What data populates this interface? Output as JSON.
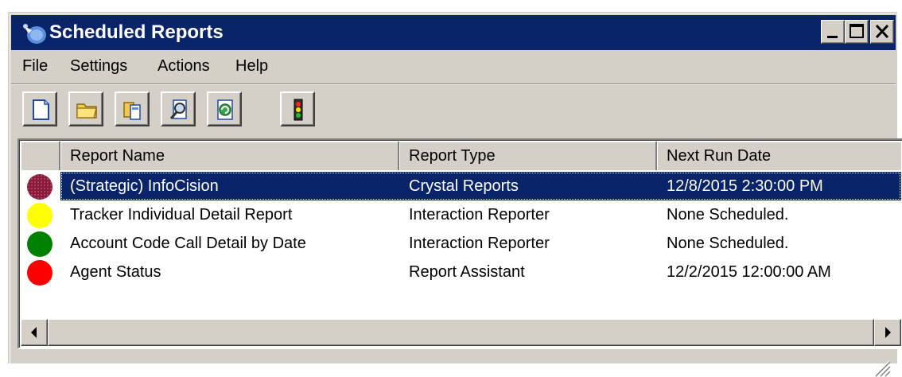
{
  "window": {
    "title": "Scheduled Reports"
  },
  "menu": [
    "File",
    "Settings",
    "Actions",
    "Help"
  ],
  "toolbar": {
    "buttons": [
      {
        "icon": "new-report-icon"
      },
      {
        "icon": "open-folder-icon"
      },
      {
        "icon": "copy-report-icon"
      },
      {
        "icon": "preview-report-icon"
      },
      {
        "icon": "refresh-report-icon"
      },
      {
        "icon": "traffic-light-icon"
      }
    ]
  },
  "table": {
    "columns": [
      "Report Name",
      "Report Type",
      "Next Run Date"
    ],
    "rows": [
      {
        "status_color": "#8b1a3a",
        "name": "(Strategic) InfoCision",
        "type": "Crystal Reports",
        "next_run": "12/8/2015 2:30:00 PM",
        "selected": true
      },
      {
        "status_color": "#ffff00",
        "name": "Tracker Individual Detail Report",
        "type": "Interaction Reporter",
        "next_run": "None Scheduled.",
        "selected": false
      },
      {
        "status_color": "#008000",
        "name": "Account Code Call Detail by Date",
        "type": "Interaction Reporter",
        "next_run": "None Scheduled.",
        "selected": false
      },
      {
        "status_color": "#ff0000",
        "name": "Agent Status",
        "type": "Report Assistant",
        "next_run": "12/2/2015 12:00:00 AM",
        "selected": false
      }
    ]
  },
  "colors": {
    "titlebar": "#0a246a",
    "selection": "#0a246a",
    "chrome": "#d4d0c8"
  }
}
